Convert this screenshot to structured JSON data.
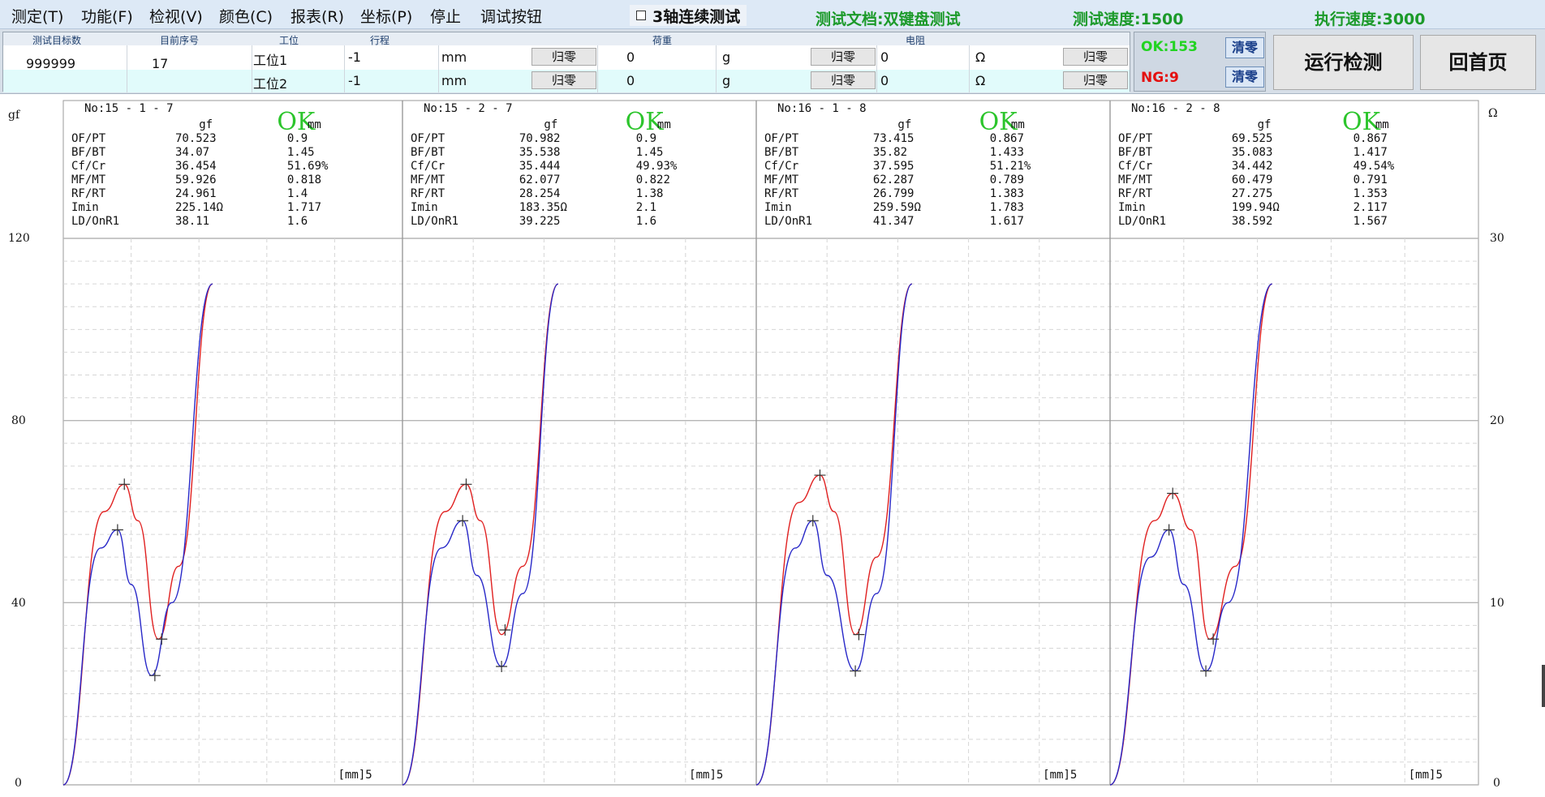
{
  "menu": {
    "items": [
      "测定(T)",
      "功能(F)",
      "检视(V)",
      "颜色(C)",
      "报表(R)",
      "坐标(P)",
      "停止",
      "调试按钮"
    ],
    "continuous_test_label": "3轴连续测试",
    "test_doc": "测试文档:双键盘测试",
    "test_speed": "测试速度:1500",
    "exec_speed": "执行速度:3000"
  },
  "control": {
    "headers": {
      "target": "测试目标数",
      "seq": "目前序号",
      "station": "工位",
      "stroke": "行程",
      "load": "荷重",
      "resistance": "电阻"
    },
    "target_value": "999999",
    "seq_value": "17",
    "zero_label": "归零",
    "rows": [
      {
        "station": "工位1",
        "stroke": "-1",
        "stroke_unit": "mm",
        "load": "0",
        "load_unit": "g",
        "res": "0",
        "res_unit": "Ω"
      },
      {
        "station": "工位2",
        "stroke": "-1",
        "stroke_unit": "mm",
        "load": "0",
        "load_unit": "g",
        "res": "0",
        "res_unit": "Ω"
      }
    ],
    "ok_count": "OK:153",
    "ng_count": "NG:9",
    "clear_label": "清零",
    "run_label": "运行检测",
    "home_label": "回首页"
  },
  "axes": {
    "left_unit": "gf",
    "right_unit": "Ω",
    "left_ticks": [
      "120",
      "80",
      "40",
      "0"
    ],
    "right_ticks": [
      "30",
      "20",
      "10",
      "0"
    ],
    "x_label": "[mm]5"
  },
  "colors": {
    "press_curve": "#e02020",
    "release_curve": "#2828c8",
    "ok_green": "#2cc52c"
  },
  "panels": [
    {
      "no": "No:15 - 1 - 7",
      "result": "OK",
      "col1": "gf",
      "col2": "mm",
      "rows": [
        [
          "OF/PT",
          "70.523",
          "0.9"
        ],
        [
          "BF/BT",
          "34.07",
          "1.45"
        ],
        [
          "Cf/Cr",
          "36.454",
          "51.69%"
        ],
        [
          "MF/MT",
          "59.926",
          "0.818"
        ],
        [
          "RF/RT",
          "24.961",
          "1.4"
        ],
        [
          "Imin",
          "225.14Ω",
          "1.717"
        ],
        [
          "LD/OnR1",
          "38.11",
          "1.6"
        ]
      ]
    },
    {
      "no": "No:15 - 2 - 7",
      "result": "OK",
      "col1": "gf",
      "col2": "mm",
      "rows": [
        [
          "OF/PT",
          "70.982",
          "0.9"
        ],
        [
          "BF/BT",
          "35.538",
          "1.45"
        ],
        [
          "Cf/Cr",
          "35.444",
          "49.93%"
        ],
        [
          "MF/MT",
          "62.077",
          "0.822"
        ],
        [
          "RF/RT",
          "28.254",
          "1.38"
        ],
        [
          "Imin",
          "183.35Ω",
          "2.1"
        ],
        [
          "LD/OnR1",
          "39.225",
          "1.6"
        ]
      ]
    },
    {
      "no": "No:16 - 1 - 8",
      "result": "OK",
      "col1": "gf",
      "col2": "mm",
      "rows": [
        [
          "OF/PT",
          "73.415",
          "0.867"
        ],
        [
          "BF/BT",
          "35.82",
          "1.433"
        ],
        [
          "Cf/Cr",
          "37.595",
          "51.21%"
        ],
        [
          "MF/MT",
          "62.287",
          "0.789"
        ],
        [
          "RF/RT",
          "26.799",
          "1.383"
        ],
        [
          "Imin",
          "259.59Ω",
          "1.783"
        ],
        [
          "LD/OnR1",
          "41.347",
          "1.617"
        ]
      ]
    },
    {
      "no": "No:16 - 2 - 8",
      "result": "OK",
      "col1": "gf",
      "col2": "mm",
      "rows": [
        [
          "OF/PT",
          "69.525",
          "0.867"
        ],
        [
          "BF/BT",
          "35.083",
          "1.417"
        ],
        [
          "Cf/Cr",
          "34.442",
          "49.54%"
        ],
        [
          "MF/MT",
          "60.479",
          "0.791"
        ],
        [
          "RF/RT",
          "27.275",
          "1.353"
        ],
        [
          "Imin",
          "199.94Ω",
          "2.117"
        ],
        [
          "LD/OnR1",
          "38.592",
          "1.567"
        ]
      ]
    }
  ],
  "chart_data": {
    "type": "line",
    "xlim": [
      0,
      5
    ],
    "ylim": [
      0,
      120
    ],
    "y2lim": [
      0,
      30
    ],
    "panels": [
      {
        "press": {
          "x": [
            0,
            0.6,
            0.9,
            1.1,
            1.4,
            1.7,
            2.2
          ],
          "y": [
            0,
            60,
            66,
            58,
            32,
            48,
            110
          ]
        },
        "release": {
          "x": [
            0,
            0.55,
            0.8,
            1.0,
            1.3,
            1.6,
            2.2
          ],
          "y": [
            0,
            52,
            56,
            44,
            24,
            40,
            110
          ]
        },
        "markers": [
          [
            0.9,
            66
          ],
          [
            0.8,
            56
          ],
          [
            1.45,
            32
          ],
          [
            1.35,
            24
          ]
        ]
      },
      {
        "press": {
          "x": [
            0,
            0.6,
            0.9,
            1.1,
            1.4,
            1.7,
            2.2
          ],
          "y": [
            0,
            60,
            66,
            58,
            33,
            48,
            110
          ]
        },
        "release": {
          "x": [
            0,
            0.55,
            0.85,
            1.05,
            1.4,
            1.7,
            2.2
          ],
          "y": [
            0,
            52,
            58,
            46,
            26,
            42,
            110
          ]
        },
        "markers": [
          [
            0.9,
            66
          ],
          [
            0.85,
            58
          ],
          [
            1.45,
            34
          ],
          [
            1.4,
            26
          ]
        ]
      },
      {
        "press": {
          "x": [
            0,
            0.6,
            0.9,
            1.1,
            1.4,
            1.7,
            2.2
          ],
          "y": [
            0,
            62,
            68,
            60,
            33,
            50,
            110
          ]
        },
        "release": {
          "x": [
            0,
            0.55,
            0.8,
            1.0,
            1.4,
            1.7,
            2.2
          ],
          "y": [
            0,
            52,
            58,
            46,
            25,
            42,
            110
          ]
        },
        "markers": [
          [
            0.9,
            68
          ],
          [
            0.8,
            58
          ],
          [
            1.45,
            33
          ],
          [
            1.4,
            25
          ]
        ]
      },
      {
        "press": {
          "x": [
            0,
            0.6,
            0.85,
            1.1,
            1.35,
            1.7,
            2.2
          ],
          "y": [
            0,
            58,
            64,
            56,
            32,
            48,
            110
          ]
        },
        "release": {
          "x": [
            0,
            0.55,
            0.8,
            1.0,
            1.3,
            1.6,
            2.2
          ],
          "y": [
            0,
            50,
            56,
            44,
            25,
            40,
            110
          ]
        },
        "markers": [
          [
            0.85,
            64
          ],
          [
            0.8,
            56
          ],
          [
            1.4,
            32
          ],
          [
            1.3,
            25
          ]
        ]
      }
    ]
  }
}
